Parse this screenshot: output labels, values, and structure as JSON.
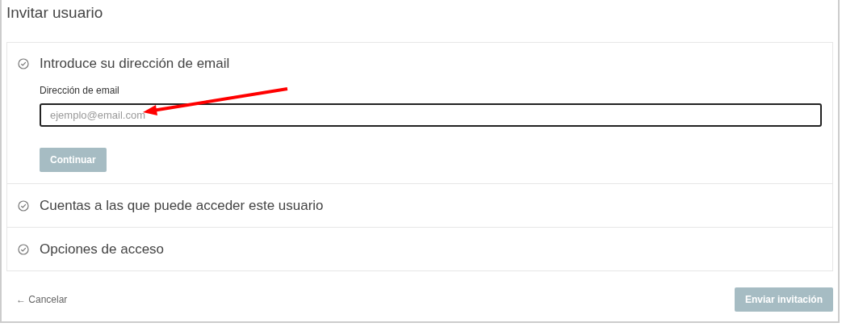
{
  "page": {
    "title": "Invitar usuario"
  },
  "steps": [
    {
      "title": "Introduce su dirección de email",
      "field": {
        "label": "Dirección de email",
        "placeholder": "ejemplo@email.com"
      },
      "button": {
        "label": "Continuar",
        "disabled": true
      }
    },
    {
      "title": "Cuentas a las que puede acceder este usuario"
    },
    {
      "title": "Opciones de acceso"
    }
  ],
  "footer": {
    "cancel": "← Cancelar",
    "submit": {
      "label": "Enviar invitación",
      "disabled": true
    }
  }
}
